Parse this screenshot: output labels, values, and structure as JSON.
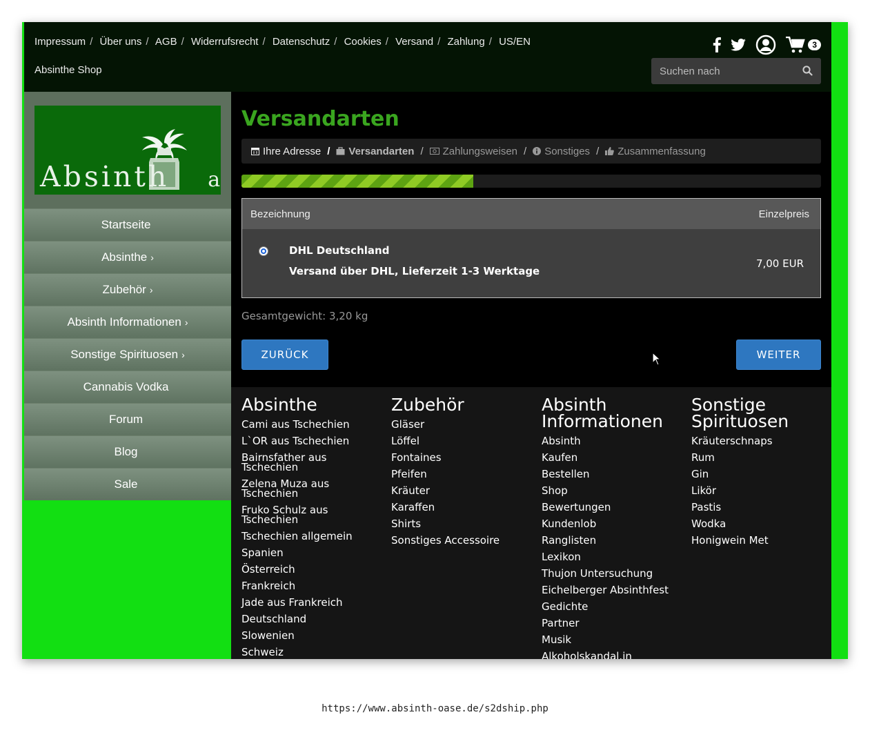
{
  "header": {
    "links": [
      {
        "label": "Impressum"
      },
      {
        "label": "Über uns"
      },
      {
        "label": "AGB"
      },
      {
        "label": "Widerrufsrecht"
      },
      {
        "label": "Datenschutz"
      },
      {
        "label": "Cookies"
      },
      {
        "label": "Versand"
      },
      {
        "label": "Zahlung"
      },
      {
        "label": "US/EN"
      }
    ],
    "separator": "/",
    "shop_name": "Absinthe Shop",
    "icons": [
      "facebook-icon",
      "twitter-icon",
      "user-icon",
      "cart-icon"
    ],
    "cart_count": "3",
    "search_placeholder": "Suchen nach"
  },
  "logo": {
    "text_main": "Absinth",
    "text_end": "ase",
    "letter": "O"
  },
  "sidebar": {
    "items": [
      {
        "label": "Startseite",
        "chevron": ""
      },
      {
        "label": "Absinthe",
        "chevron": "›"
      },
      {
        "label": "Zubehör",
        "chevron": "›"
      },
      {
        "label": "Absinth Informationen",
        "chevron": "›"
      },
      {
        "label": "Sonstige Spirituosen",
        "chevron": "›"
      },
      {
        "label": "Cannabis Vodka",
        "chevron": ""
      },
      {
        "label": "Forum",
        "chevron": ""
      },
      {
        "label": "Blog",
        "chevron": ""
      },
      {
        "label": "Sale",
        "chevron": ""
      }
    ]
  },
  "main": {
    "title": "Versandarten",
    "steps": [
      {
        "label": "Ihre Adresse",
        "icon": "calendar-icon",
        "state": "done"
      },
      {
        "label": "Versandarten",
        "icon": "briefcase-icon",
        "state": "active"
      },
      {
        "label": "Zahlungsweisen",
        "icon": "money-icon",
        "state": "pending"
      },
      {
        "label": "Sonstiges",
        "icon": "info-icon",
        "state": "pending"
      },
      {
        "label": "Zusammenfassung",
        "icon": "thumbs-up-icon",
        "state": "pending"
      }
    ],
    "progress_fraction": 0.4,
    "table": {
      "col_name": "Bezeichnung",
      "col_price": "Einzelpreis",
      "rows": [
        {
          "name": "DHL Deutschland",
          "description": "Versand über DHL, Lieferzeit 1-3 Werktage",
          "price": "7,00 EUR",
          "selected": true
        }
      ]
    },
    "weight": "Gesamtgewicht: 3,20 kg",
    "back_label": "ZURÜCK",
    "next_label": "WEITER"
  },
  "footer": {
    "columns": [
      {
        "title": "Absinthe",
        "links": [
          "Cami aus Tschechien",
          "L`OR aus Tschechien",
          "Bairnsfather aus Tschechien",
          "Zelena Muza aus Tschechien",
          "Fruko Schulz aus Tschechien",
          "Tschechien allgemein",
          "Spanien",
          "Österreich",
          "Frankreich",
          "Jade aus Frankreich",
          "Deutschland",
          "Slowenien",
          "Schweiz"
        ]
      },
      {
        "title": "Zubehör",
        "links": [
          "Gläser",
          "Löffel",
          "Fontaines",
          "Pfeifen",
          "Kräuter",
          "Karaffen",
          "Shirts",
          "Sonstiges Accessoire"
        ]
      },
      {
        "title": "Absinth Informationen",
        "links": [
          "Absinth",
          "Kaufen",
          "Bestellen",
          "Shop",
          "Bewertungen",
          "Kundenlob",
          "Ranglisten",
          "Lexikon",
          "Thujon Untersuchung",
          "Eichelberger Absinthfest",
          "Gedichte",
          "Partner",
          "Musik",
          "Alkoholskandal.in"
        ]
      },
      {
        "title": "Sonstige Spirituosen",
        "links": [
          "Kräuterschnaps",
          "Rum",
          "Gin",
          "Likör",
          "Pastis",
          "Wodka",
          "Honigwein Met"
        ]
      }
    ]
  },
  "address_bar": {
    "url": "https://www.absinth-oase.de/s2dship.php"
  },
  "colors": {
    "page_green": "#12df12",
    "title_green": "#3aa51f",
    "button_blue": "#2e77c0",
    "header_bg": "#041404"
  }
}
